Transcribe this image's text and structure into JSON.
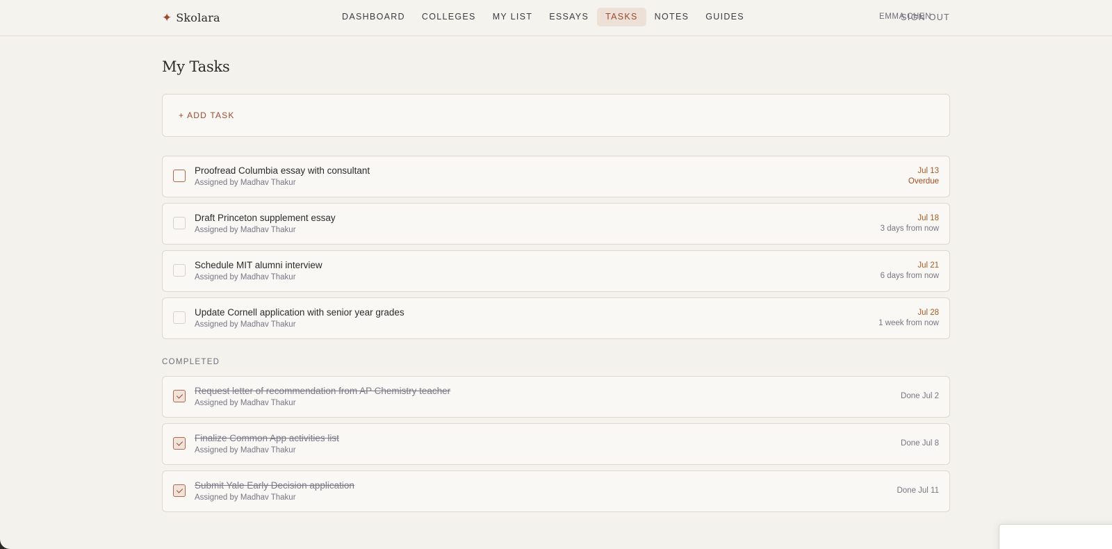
{
  "brand": {
    "icon": "sparkle-icon",
    "name": "Skolara"
  },
  "nav": [
    {
      "label": "DASHBOARD",
      "active": false
    },
    {
      "label": "COLLEGES",
      "active": false
    },
    {
      "label": "MY LIST",
      "active": false
    },
    {
      "label": "ESSAYS",
      "active": false
    },
    {
      "label": "TASKS",
      "active": true
    },
    {
      "label": "NOTES",
      "active": false
    },
    {
      "label": "GUIDES",
      "active": false
    }
  ],
  "header": {
    "user": "EMMA CHEN",
    "sign_out": "SIGN OUT"
  },
  "page": {
    "title": "My Tasks",
    "add_task": "+ ADD TASK"
  },
  "tasks": [
    {
      "title": "Proofread Columbia essay with consultant",
      "assignee": "Assigned by Madhav Thakur",
      "date": "Jul 13",
      "relative": "Overdue",
      "overdue": true
    },
    {
      "title": "Draft Princeton supplement essay",
      "assignee": "Assigned by Madhav Thakur",
      "date": "Jul 18",
      "relative": "3 days from now",
      "overdue": false
    },
    {
      "title": "Schedule MIT alumni interview",
      "assignee": "Assigned by Madhav Thakur",
      "date": "Jul 21",
      "relative": "6 days from now",
      "overdue": false
    },
    {
      "title": "Update Cornell application with senior year grades",
      "assignee": "Assigned by Madhav Thakur",
      "date": "Jul 28",
      "relative": "1 week from now",
      "overdue": false
    }
  ],
  "completed": {
    "label": "COMPLETED",
    "items": [
      {
        "title": "Request letter of recommendation from AP Chemistry teacher",
        "assignee": "Assigned by Madhav Thakur",
        "done": "Done Jul 2"
      },
      {
        "title": "Finalize Common App activities list",
        "assignee": "Assigned by Madhav Thakur",
        "done": "Done Jul 8"
      },
      {
        "title": "Submit Yale Early Decision application",
        "assignee": "Assigned by Madhav Thakur",
        "done": "Done Jul 11"
      }
    ]
  },
  "colors": {
    "accent": "#9a4a2e",
    "due_date": "#a65a22",
    "background": "#f4f2ed",
    "card": "#faf8f5"
  }
}
